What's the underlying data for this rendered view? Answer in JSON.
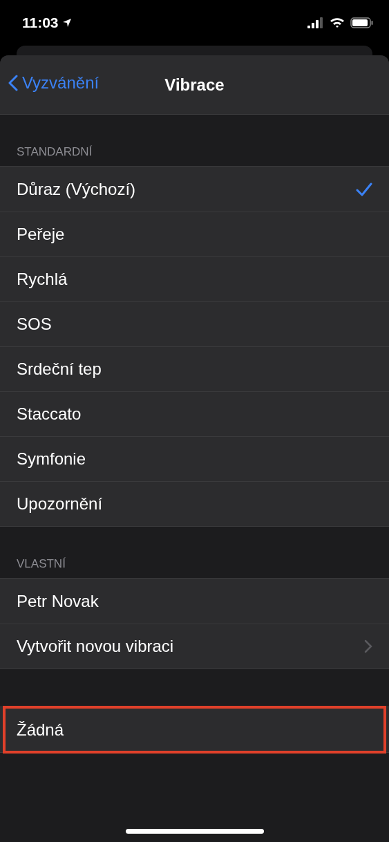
{
  "status_bar": {
    "time": "11:03"
  },
  "nav": {
    "back": "Vyzvánění",
    "title": "Vibrace"
  },
  "sections": [
    {
      "header": "STANDARDNÍ",
      "rows": [
        {
          "label": "Důraz (Výchozí)",
          "selected": true,
          "kind": "option"
        },
        {
          "label": "Peřeje",
          "selected": false,
          "kind": "option"
        },
        {
          "label": "Rychlá",
          "selected": false,
          "kind": "option"
        },
        {
          "label": "SOS",
          "selected": false,
          "kind": "option"
        },
        {
          "label": "Srdeční tep",
          "selected": false,
          "kind": "option"
        },
        {
          "label": "Staccato",
          "selected": false,
          "kind": "option"
        },
        {
          "label": "Symfonie",
          "selected": false,
          "kind": "option"
        },
        {
          "label": "Upozornění",
          "selected": false,
          "kind": "option"
        }
      ]
    },
    {
      "header": "VLASTNÍ",
      "rows": [
        {
          "label": "Petr Novak",
          "selected": false,
          "kind": "option"
        },
        {
          "label": "Vytvořit novou vibraci",
          "kind": "link"
        }
      ]
    },
    {
      "rows": [
        {
          "label": "Žádná",
          "selected": false,
          "kind": "option",
          "highlighted": true
        }
      ]
    }
  ]
}
